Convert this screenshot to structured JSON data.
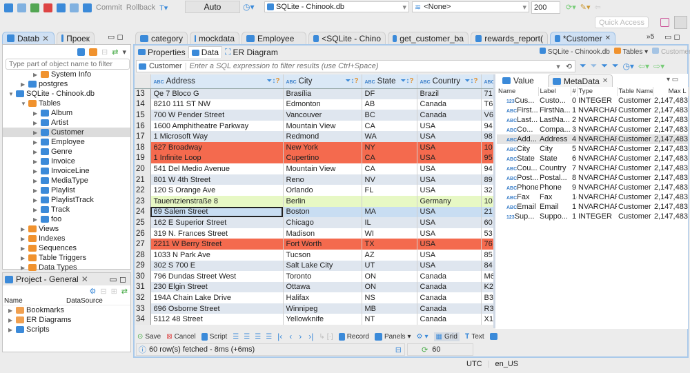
{
  "toolbar": {
    "commit": "Commit",
    "rollback": "Rollback",
    "mode": "Auto",
    "connection": "SQLite - Chinook.db",
    "schema": "<None>",
    "limit": "200",
    "quick_access": "Quick Access"
  },
  "left_tabs": [
    {
      "label": "Datab"
    },
    {
      "label": "Проек"
    }
  ],
  "navigator": {
    "filter_placeholder": "Type part of object name to filter",
    "items": [
      {
        "label": "System Info",
        "level": 2,
        "icon": "info"
      },
      {
        "label": "postgres",
        "level": 1,
        "icon": "db"
      },
      {
        "label": "SQLite - Chinook.db",
        "level": 0,
        "icon": "db",
        "expanded": true
      },
      {
        "label": "Tables",
        "level": 1,
        "icon": "folder",
        "expanded": true
      },
      {
        "label": "Album",
        "level": 2,
        "icon": "table"
      },
      {
        "label": "Artist",
        "level": 2,
        "icon": "table"
      },
      {
        "label": "Customer",
        "level": 2,
        "icon": "table",
        "selected": true
      },
      {
        "label": "Employee",
        "level": 2,
        "icon": "table"
      },
      {
        "label": "Genre",
        "level": 2,
        "icon": "table"
      },
      {
        "label": "Invoice",
        "level": 2,
        "icon": "table"
      },
      {
        "label": "InvoiceLine",
        "level": 2,
        "icon": "table"
      },
      {
        "label": "MediaType",
        "level": 2,
        "icon": "table"
      },
      {
        "label": "Playlist",
        "level": 2,
        "icon": "table"
      },
      {
        "label": "PlaylistTrack",
        "level": 2,
        "icon": "table"
      },
      {
        "label": "Track",
        "level": 2,
        "icon": "table"
      },
      {
        "label": "foo",
        "level": 2,
        "icon": "table"
      },
      {
        "label": "Views",
        "level": 1,
        "icon": "view"
      },
      {
        "label": "Indexes",
        "level": 1,
        "icon": "folder"
      },
      {
        "label": "Sequences",
        "level": 1,
        "icon": "folder"
      },
      {
        "label": "Table Triggers",
        "level": 1,
        "icon": "folder"
      },
      {
        "label": "Data Types",
        "level": 1,
        "icon": "folder"
      }
    ]
  },
  "project": {
    "title": "Project - General",
    "col_name": "Name",
    "col_datasource": "DataSource",
    "items": [
      "Bookmarks",
      "ER Diagrams",
      "Scripts"
    ]
  },
  "editor_tabs": [
    {
      "label": "category"
    },
    {
      "label": "mockdata"
    },
    {
      "label": "Employee"
    },
    {
      "label": "<SQLite - Chino"
    },
    {
      "label": "get_customer_ba"
    },
    {
      "label": "rewards_report("
    },
    {
      "label": "*Customer",
      "active": true
    }
  ],
  "editor_tabs_overflow": "5",
  "sub_tabs": [
    "Properties",
    "Data",
    "ER Diagram"
  ],
  "breadcrumb": {
    "connection": "SQLite - Chinook.db",
    "folder": "Tables",
    "table": "Customer"
  },
  "filter": {
    "table": "Customer",
    "placeholder": "Enter a SQL expression to filter results (use Ctrl+Space)"
  },
  "grid": {
    "columns": [
      "Address",
      "City",
      "State",
      "Country",
      ""
    ],
    "rows": [
      {
        "n": "13",
        "c": [
          "Qe 7 Bloco G",
          "Brasília",
          "DF",
          "Brazil",
          "71"
        ]
      },
      {
        "n": "14",
        "c": [
          "8210 111 ST NW",
          "Edmonton",
          "AB",
          "Canada",
          "T6"
        ]
      },
      {
        "n": "15",
        "c": [
          "700 W Pender Street",
          "Vancouver",
          "BC",
          "Canada",
          "V6"
        ]
      },
      {
        "n": "16",
        "c": [
          "1600 Amphitheatre Parkway",
          "Mountain View",
          "CA",
          "USA",
          "94"
        ]
      },
      {
        "n": "17",
        "c": [
          "1 Microsoft Way",
          "Redmond",
          "WA",
          "USA",
          "98"
        ]
      },
      {
        "n": "18",
        "c": [
          "627 Broadway",
          "New York",
          "NY",
          "USA",
          "10"
        ],
        "hl": "red"
      },
      {
        "n": "19",
        "c": [
          "1 Infinite Loop",
          "Cupertino",
          "CA",
          "USA",
          "95"
        ],
        "hl": "red"
      },
      {
        "n": "20",
        "c": [
          "541 Del Medio Avenue",
          "Mountain View",
          "CA",
          "USA",
          "94"
        ]
      },
      {
        "n": "21",
        "c": [
          "801 W 4th Street",
          "Reno",
          "NV",
          "USA",
          "89"
        ]
      },
      {
        "n": "22",
        "c": [
          "120 S Orange Ave",
          "Orlando",
          "FL",
          "USA",
          "32"
        ]
      },
      {
        "n": "23",
        "c": [
          "Tauentzienstraße 8",
          "Berlin",
          "",
          "Germany",
          "10"
        ],
        "hl": "green"
      },
      {
        "n": "24",
        "c": [
          "69 Salem Street",
          "Boston",
          "MA",
          "USA",
          "21"
        ],
        "hl": "selected"
      },
      {
        "n": "25",
        "c": [
          "162 E Superior Street",
          "Chicago",
          "IL",
          "USA",
          "60"
        ]
      },
      {
        "n": "26",
        "c": [
          "319 N. Frances Street",
          "Madison",
          "WI",
          "USA",
          "53"
        ]
      },
      {
        "n": "27",
        "c": [
          "2211 W Berry Street",
          "Fort Worth",
          "TX",
          "USA",
          "76"
        ],
        "hl": "red"
      },
      {
        "n": "28",
        "c": [
          "1033 N Park Ave",
          "Tucson",
          "AZ",
          "USA",
          "85"
        ]
      },
      {
        "n": "29",
        "c": [
          "302 S 700 E",
          "Salt Lake City",
          "UT",
          "USA",
          "84"
        ]
      },
      {
        "n": "30",
        "c": [
          "796 Dundas Street West",
          "Toronto",
          "ON",
          "Canada",
          "M6"
        ]
      },
      {
        "n": "31",
        "c": [
          "230 Elgin Street",
          "Ottawa",
          "ON",
          "Canada",
          "K2"
        ]
      },
      {
        "n": "32",
        "c": [
          "194A Chain Lake Drive",
          "Halifax",
          "NS",
          "Canada",
          "B3"
        ]
      },
      {
        "n": "33",
        "c": [
          "696 Osborne Street",
          "Winnipeg",
          "MB",
          "Canada",
          "R3"
        ]
      },
      {
        "n": "34",
        "c": [
          "5112 48 Street",
          "Yellowknife",
          "NT",
          "Canada",
          "X1"
        ]
      }
    ]
  },
  "side_tabs": [
    "Value",
    "MetaData"
  ],
  "metadata": {
    "columns": [
      "Name",
      "Label",
      "#",
      "Type",
      "Table Name",
      "Max L"
    ],
    "rows": [
      [
        "123",
        "Cus...",
        "Custo...",
        "0",
        "INTEGER",
        "Customer",
        "2,147,483"
      ],
      [
        "ABC",
        "First...",
        "FirstNa...",
        "1",
        "NVARCHAR",
        "Customer",
        "2,147,483"
      ],
      [
        "ABC",
        "Last...",
        "LastNa...",
        "2",
        "NVARCHAR",
        "Customer",
        "2,147,483"
      ],
      [
        "ABC",
        "Co...",
        "Compa...",
        "3",
        "NVARCHAR",
        "Customer",
        "2,147,483"
      ],
      [
        "ABC",
        "Add...",
        "Address",
        "4",
        "NVARCHAR",
        "Customer",
        "2,147,483"
      ],
      [
        "ABC",
        "City",
        "City",
        "5",
        "NVARCHAR",
        "Customer",
        "2,147,483"
      ],
      [
        "ABC",
        "State",
        "State",
        "6",
        "NVARCHAR",
        "Customer",
        "2,147,483"
      ],
      [
        "ABC",
        "Cou...",
        "Country",
        "7",
        "NVARCHAR",
        "Customer",
        "2,147,483"
      ],
      [
        "ABC",
        "Post...",
        "Postal...",
        "8",
        "NVARCHAR",
        "Customer",
        "2,147,483"
      ],
      [
        "ABC",
        "Phone",
        "Phone",
        "9",
        "NVARCHAR",
        "Customer",
        "2,147,483"
      ],
      [
        "ABC",
        "Fax",
        "Fax",
        "1(",
        "NVARCHAR",
        "Customer",
        "2,147,483"
      ],
      [
        "ABC",
        "Email",
        "Email",
        "1",
        "NVARCHAR",
        "Customer",
        "2,147,483"
      ],
      [
        "123",
        "Sup...",
        "Suppo...",
        "1:",
        "INTEGER",
        "Customer",
        "2,147,483"
      ]
    ]
  },
  "bottom": {
    "save": "Save",
    "cancel": "Cancel",
    "script": "Script",
    "record": "Record",
    "panels": "Panels",
    "grid": "Grid",
    "text": "Text",
    "status": "60 row(s) fetched - 8ms (+6ms)",
    "count": "60"
  },
  "statusbar": {
    "tz": "UTC",
    "locale": "en_US"
  },
  "colors": {
    "accent": "#3b8ad9",
    "row_red": "#f46a4e",
    "row_green": "#e7f8c4",
    "row_alt": "#dfe6ef",
    "row_selected": "#c8ddf2"
  }
}
